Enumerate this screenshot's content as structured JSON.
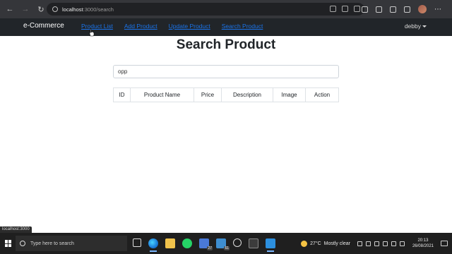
{
  "browser": {
    "url_host": "localhost",
    "url_path": ":3000/search",
    "back_icon": "arrow-left-icon",
    "forward_icon": "arrow-right-icon",
    "reload_icon": "reload-icon"
  },
  "navbar": {
    "brand": "e-Commerce",
    "links": [
      "Product List",
      "Add Product",
      "Update Product",
      "Search Product"
    ],
    "user": "debby"
  },
  "page": {
    "title": "Search Product",
    "search_value": "opp"
  },
  "table": {
    "headers": [
      "ID",
      "Product Name",
      "Price",
      "Description",
      "Image",
      "Action"
    ]
  },
  "status_url": "localhost:3000",
  "taskbar": {
    "search_placeholder": "Type here to search",
    "badge_1": "27",
    "badge_2": "61",
    "temperature": "27°C",
    "weather": "Mostly clear",
    "time": "20:13",
    "date": "26/08/2021"
  },
  "colors": {
    "navbar_bg": "#212529",
    "link": "#1a73e8",
    "browser_bg": "#35363a",
    "taskbar_bg": "#1f1f1f"
  }
}
